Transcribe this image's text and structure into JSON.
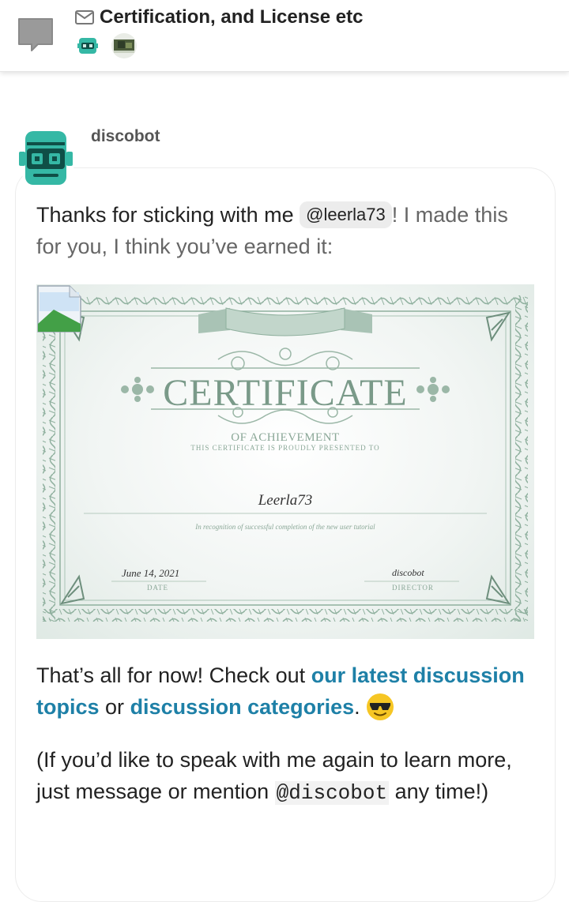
{
  "header": {
    "title": "Certification, and License etc",
    "participants": [
      "discobot-avatar",
      "user-photo-avatar"
    ]
  },
  "post": {
    "username": "discobot",
    "intro_text": "Thanks for sticking with me",
    "mention": "@leerla73",
    "intro_rest": "! I made this for you, I think you’ve earned it:",
    "certificate": {
      "title": "CERTIFICATE",
      "subtitle": "OF ACHIEVEMENT",
      "presented_to": "THIS CERTIFICATE IS PROUDLY PRESENTED TO",
      "name": "Leerla73",
      "recognition": "In recognition of successful completion of the new user tutorial",
      "date": "June 14, 2021",
      "date_label": "DATE",
      "signature": "discobot",
      "signature_label": "DIRECTOR"
    },
    "outro_prefix": "That’s all for now! Check out",
    "link_latest": "our latest discussion topics",
    "outro_or": "or",
    "link_categories": "discussion categories",
    "outro_period": ".",
    "help_prefix": "(If you’d like to speak with me again to learn more, just message or mention",
    "help_code": "@discobot",
    "help_suffix": "any time!)"
  },
  "colors": {
    "link": "#1e80a7",
    "discobot_teal": "#35b8a5",
    "certificate_green": "#7a9a89"
  }
}
